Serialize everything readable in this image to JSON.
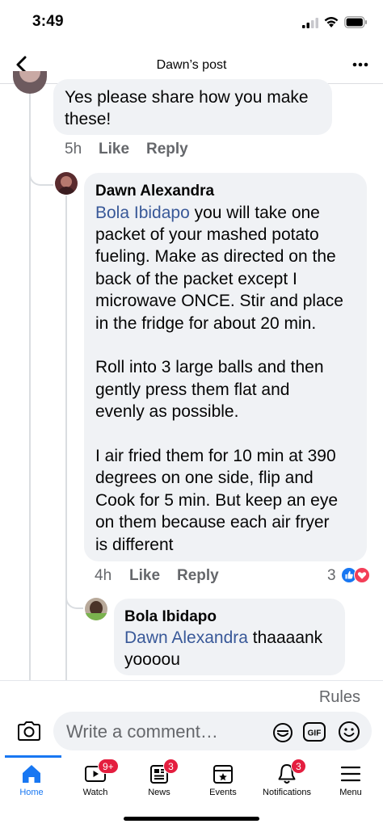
{
  "status_bar": {
    "time": "3:49"
  },
  "header": {
    "title": "Dawn’s post"
  },
  "comments": [
    {
      "lines": [
        "Yes please share how you make",
        "these!"
      ],
      "time": "5h",
      "like_label": "Like",
      "reply_label": "Reply"
    },
    {
      "author": "Dawn Alexandra",
      "mention": "Bola Ibidapo",
      "first_line_rest": " you will take one",
      "lines": [
        "packet of your mashed potato",
        "fueling. Make as directed on the",
        "back of the packet except I",
        "microwave ONCE. Stir and place",
        "in the fridge for about 20 min.",
        "",
        "Roll into 3 large balls and then",
        "gently press them flat and",
        "evenly as possible.",
        "",
        "I air fried them for 10 min at 390",
        "degrees on one side, flip and",
        "Cook for 5 min. But keep an eye",
        "on them because each air fryer",
        "is different"
      ],
      "time": "4h",
      "like_label": "Like",
      "reply_label": "Reply",
      "reaction_count": "3",
      "reactions": [
        "like",
        "love"
      ]
    },
    {
      "author": "Bola Ibidapo",
      "mention": "Dawn Alexandra",
      "first_line_rest": " thaaaank",
      "lines": [
        "yoooou"
      ]
    }
  ],
  "comment_bar": {
    "rules_label": "Rules",
    "placeholder": "Write a comment…"
  },
  "tabs": [
    {
      "label": "Home",
      "icon": "home-icon",
      "active": true,
      "badge": ""
    },
    {
      "label": "Watch",
      "icon": "watch-icon",
      "active": false,
      "badge": "9+"
    },
    {
      "label": "News",
      "icon": "news-icon",
      "active": false,
      "badge": "3"
    },
    {
      "label": "Events",
      "icon": "events-icon",
      "active": false,
      "badge": ""
    },
    {
      "label": "Notifications",
      "icon": "bell-icon",
      "active": false,
      "badge": "3"
    },
    {
      "label": "Menu",
      "icon": "menu-icon",
      "active": false,
      "badge": ""
    }
  ],
  "colors": {
    "accent": "#1877f2",
    "mention": "#385898",
    "badge": "#e41e3f",
    "bubble": "#f0f2f5",
    "meta": "#65676b"
  }
}
